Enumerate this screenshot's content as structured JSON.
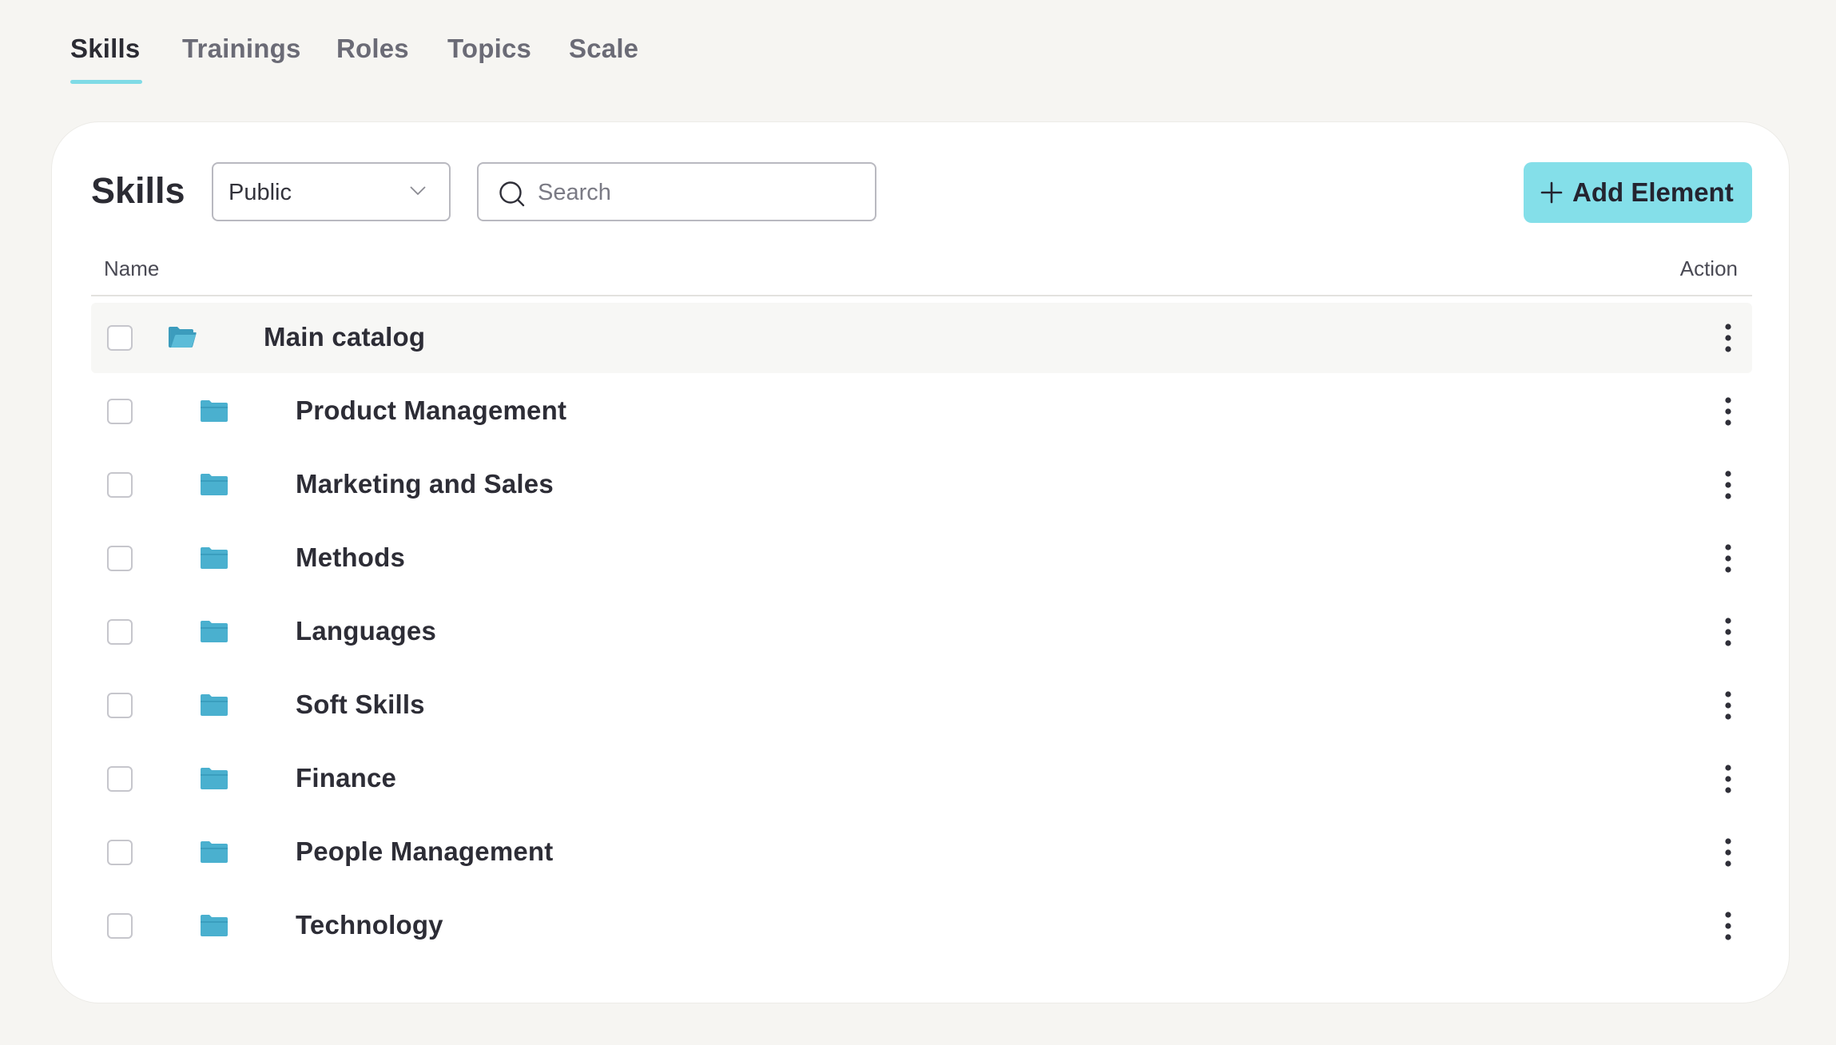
{
  "tabs": [
    {
      "label": "Skills",
      "active": true
    },
    {
      "label": "Trainings",
      "active": false
    },
    {
      "label": "Roles",
      "active": false
    },
    {
      "label": "Topics",
      "active": false
    },
    {
      "label": "Scale",
      "active": false
    }
  ],
  "card": {
    "title": "Skills",
    "visibility_select": {
      "value": "Public"
    },
    "search": {
      "placeholder": "Search"
    },
    "add_button_label": "Add Element"
  },
  "table": {
    "columns": {
      "name": "Name",
      "action": "Action"
    },
    "parent": {
      "label": "Main catalog",
      "icon": "folder-open-icon"
    },
    "rows": [
      {
        "label": "Product Management",
        "icon": "folder-icon"
      },
      {
        "label": "Marketing and Sales",
        "icon": "folder-icon"
      },
      {
        "label": "Methods",
        "icon": "folder-icon"
      },
      {
        "label": "Languages",
        "icon": "folder-icon"
      },
      {
        "label": "Soft Skills",
        "icon": "folder-icon"
      },
      {
        "label": "Finance",
        "icon": "folder-icon"
      },
      {
        "label": "People Management",
        "icon": "folder-icon"
      },
      {
        "label": "Technology",
        "icon": "folder-icon"
      }
    ]
  },
  "colors": {
    "accent": "#80dbe6",
    "button": "#84dfe9",
    "folder": "#4ab0cf",
    "background": "#f6f5f2"
  }
}
